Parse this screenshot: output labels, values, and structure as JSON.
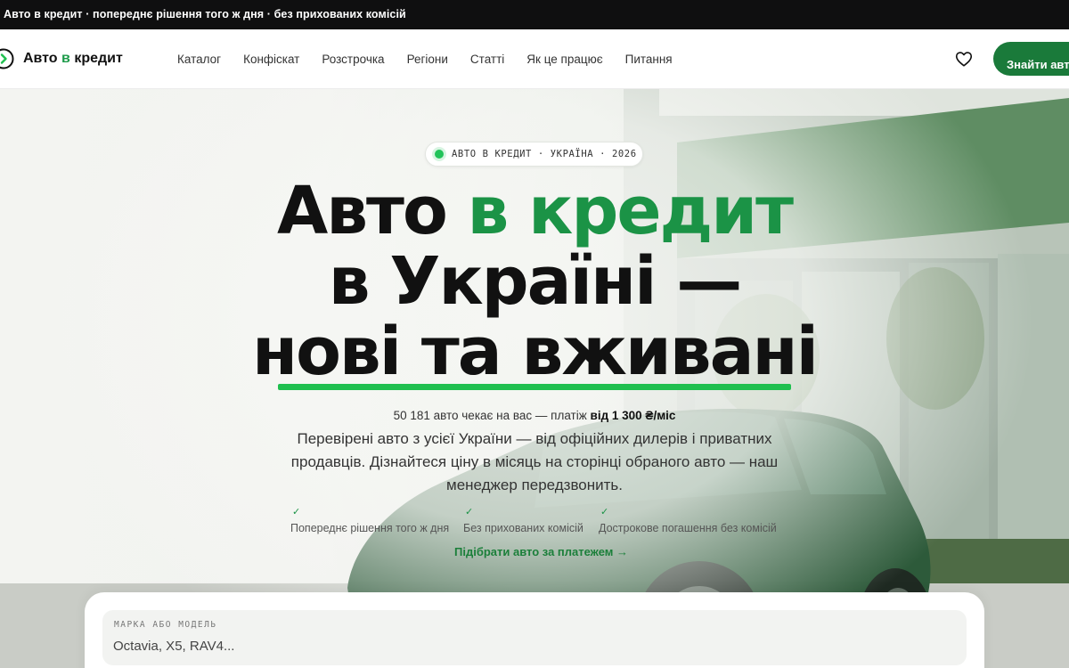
{
  "topbar": {
    "text": "Авто в кредит · попереднє рішення того ж дня · без прихованих комісій"
  },
  "header": {
    "logo_text_part1": "Авто ",
    "logo_text_green": "в",
    "logo_text_part2": " кредит",
    "nav": [
      "Каталог",
      "Конфіскат",
      "Розстрочка",
      "Регіони",
      "Статті",
      "Як це працює",
      "Питання"
    ],
    "cta_label": "Знайти авто"
  },
  "hero": {
    "badge": "АВТО В КРЕДИТ · УКРАЇНА · 2026",
    "headline_part1": "Авто ",
    "headline_green": "в кредит",
    "headline_line2": "в Україні —",
    "headline_line3": "нові та вживані",
    "stats_prefix": "50 181 авто чекає на вас — платіж ",
    "stats_bold": "від 1 300 ₴/міс",
    "description": "Перевірені авто з усієї України — від офіційних дилерів і приватних продавців. Дізнайтеся ціну в місяць на сторінці обраного авто — наш менеджер передзвонить.",
    "features": [
      "Попереднє рішення того ж дня",
      "Без прихованих комісій",
      "Дострокове погашення без комісій"
    ],
    "link": "Підібрати авто за платежем →"
  },
  "search": {
    "label": "МАРКА АБО МОДЕЛЬ",
    "placeholder": "Octavia, X5, RAV4..."
  },
  "colors": {
    "brand_green": "#1b9346",
    "cta_green": "#1a7a3a",
    "accent_green": "#1fbf4f",
    "topbar_bg": "#0f0f10"
  },
  "icons": {
    "logo": "arrow-circle-icon",
    "favorite": "heart-icon",
    "feature": "check-icon",
    "badge": "status-dot-icon"
  }
}
